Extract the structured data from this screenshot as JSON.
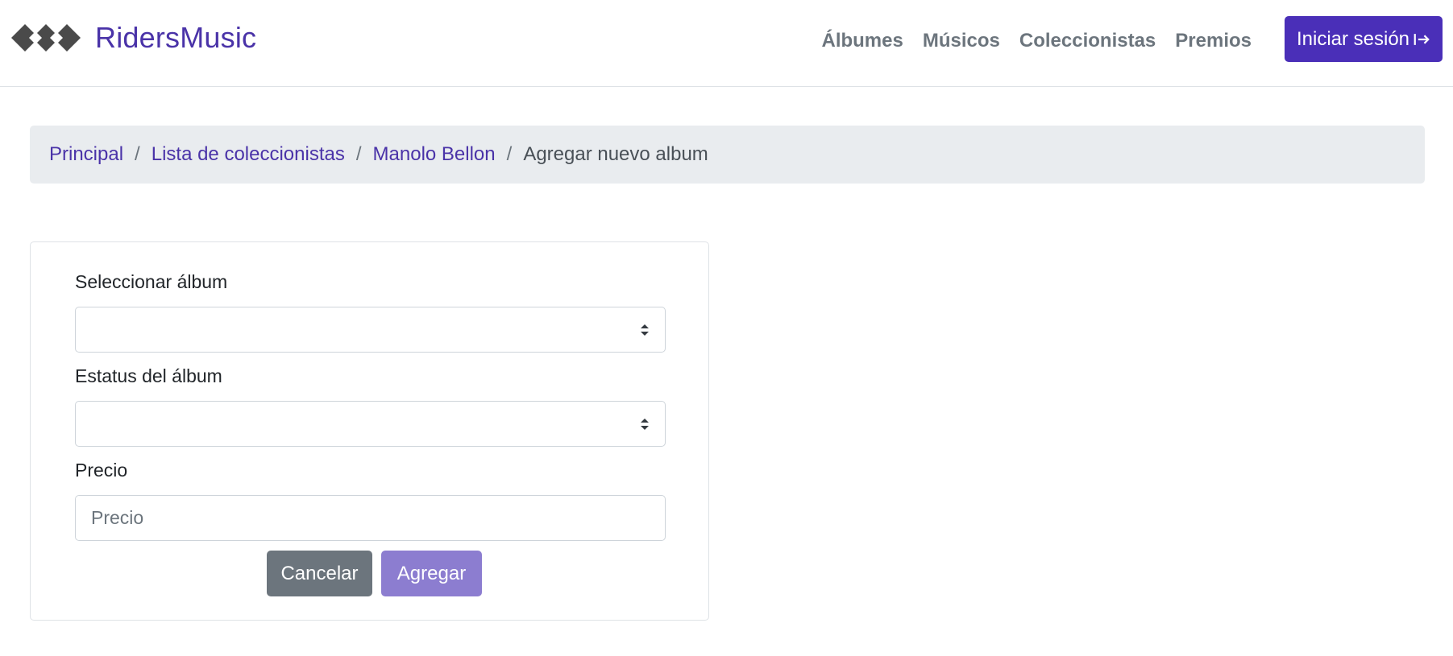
{
  "brand": {
    "name": "RidersMusic",
    "logo_icon": "diamonds-logo-icon"
  },
  "nav": {
    "links": [
      "Álbumes",
      "Músicos",
      "Coleccionistas",
      "Premios"
    ],
    "login_label": "Iniciar sesión",
    "login_icon": "box-arrow-in-right-icon",
    "accent": "#4a2fb8"
  },
  "breadcrumb": {
    "items": [
      "Principal",
      "Lista de coleccionistas",
      "Manolo Bellon"
    ],
    "active": "Agregar nuevo album"
  },
  "form": {
    "album_label": "Seleccionar álbum",
    "album_value": "",
    "status_label": "Estatus del álbum",
    "status_value": "",
    "price_label": "Precio",
    "price_value": "",
    "price_placeholder": "Precio",
    "cancel_label": "Cancelar",
    "submit_label": "Agregar"
  }
}
